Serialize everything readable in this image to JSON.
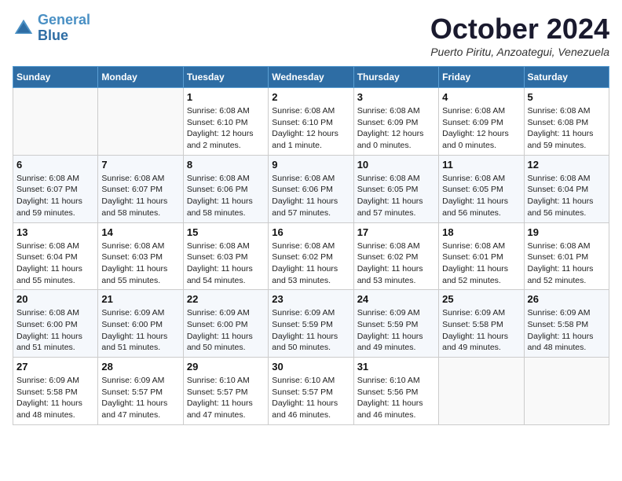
{
  "header": {
    "logo_line1": "General",
    "logo_line2": "Blue",
    "month": "October 2024",
    "location": "Puerto Piritu, Anzoategui, Venezuela"
  },
  "weekdays": [
    "Sunday",
    "Monday",
    "Tuesday",
    "Wednesday",
    "Thursday",
    "Friday",
    "Saturday"
  ],
  "weeks": [
    [
      {
        "day": "",
        "detail": ""
      },
      {
        "day": "",
        "detail": ""
      },
      {
        "day": "1",
        "detail": "Sunrise: 6:08 AM\nSunset: 6:10 PM\nDaylight: 12 hours\nand 2 minutes."
      },
      {
        "day": "2",
        "detail": "Sunrise: 6:08 AM\nSunset: 6:10 PM\nDaylight: 12 hours\nand 1 minute."
      },
      {
        "day": "3",
        "detail": "Sunrise: 6:08 AM\nSunset: 6:09 PM\nDaylight: 12 hours\nand 0 minutes."
      },
      {
        "day": "4",
        "detail": "Sunrise: 6:08 AM\nSunset: 6:09 PM\nDaylight: 12 hours\nand 0 minutes."
      },
      {
        "day": "5",
        "detail": "Sunrise: 6:08 AM\nSunset: 6:08 PM\nDaylight: 11 hours\nand 59 minutes."
      }
    ],
    [
      {
        "day": "6",
        "detail": "Sunrise: 6:08 AM\nSunset: 6:07 PM\nDaylight: 11 hours\nand 59 minutes."
      },
      {
        "day": "7",
        "detail": "Sunrise: 6:08 AM\nSunset: 6:07 PM\nDaylight: 11 hours\nand 58 minutes."
      },
      {
        "day": "8",
        "detail": "Sunrise: 6:08 AM\nSunset: 6:06 PM\nDaylight: 11 hours\nand 58 minutes."
      },
      {
        "day": "9",
        "detail": "Sunrise: 6:08 AM\nSunset: 6:06 PM\nDaylight: 11 hours\nand 57 minutes."
      },
      {
        "day": "10",
        "detail": "Sunrise: 6:08 AM\nSunset: 6:05 PM\nDaylight: 11 hours\nand 57 minutes."
      },
      {
        "day": "11",
        "detail": "Sunrise: 6:08 AM\nSunset: 6:05 PM\nDaylight: 11 hours\nand 56 minutes."
      },
      {
        "day": "12",
        "detail": "Sunrise: 6:08 AM\nSunset: 6:04 PM\nDaylight: 11 hours\nand 56 minutes."
      }
    ],
    [
      {
        "day": "13",
        "detail": "Sunrise: 6:08 AM\nSunset: 6:04 PM\nDaylight: 11 hours\nand 55 minutes."
      },
      {
        "day": "14",
        "detail": "Sunrise: 6:08 AM\nSunset: 6:03 PM\nDaylight: 11 hours\nand 55 minutes."
      },
      {
        "day": "15",
        "detail": "Sunrise: 6:08 AM\nSunset: 6:03 PM\nDaylight: 11 hours\nand 54 minutes."
      },
      {
        "day": "16",
        "detail": "Sunrise: 6:08 AM\nSunset: 6:02 PM\nDaylight: 11 hours\nand 53 minutes."
      },
      {
        "day": "17",
        "detail": "Sunrise: 6:08 AM\nSunset: 6:02 PM\nDaylight: 11 hours\nand 53 minutes."
      },
      {
        "day": "18",
        "detail": "Sunrise: 6:08 AM\nSunset: 6:01 PM\nDaylight: 11 hours\nand 52 minutes."
      },
      {
        "day": "19",
        "detail": "Sunrise: 6:08 AM\nSunset: 6:01 PM\nDaylight: 11 hours\nand 52 minutes."
      }
    ],
    [
      {
        "day": "20",
        "detail": "Sunrise: 6:08 AM\nSunset: 6:00 PM\nDaylight: 11 hours\nand 51 minutes."
      },
      {
        "day": "21",
        "detail": "Sunrise: 6:09 AM\nSunset: 6:00 PM\nDaylight: 11 hours\nand 51 minutes."
      },
      {
        "day": "22",
        "detail": "Sunrise: 6:09 AM\nSunset: 6:00 PM\nDaylight: 11 hours\nand 50 minutes."
      },
      {
        "day": "23",
        "detail": "Sunrise: 6:09 AM\nSunset: 5:59 PM\nDaylight: 11 hours\nand 50 minutes."
      },
      {
        "day": "24",
        "detail": "Sunrise: 6:09 AM\nSunset: 5:59 PM\nDaylight: 11 hours\nand 49 minutes."
      },
      {
        "day": "25",
        "detail": "Sunrise: 6:09 AM\nSunset: 5:58 PM\nDaylight: 11 hours\nand 49 minutes."
      },
      {
        "day": "26",
        "detail": "Sunrise: 6:09 AM\nSunset: 5:58 PM\nDaylight: 11 hours\nand 48 minutes."
      }
    ],
    [
      {
        "day": "27",
        "detail": "Sunrise: 6:09 AM\nSunset: 5:58 PM\nDaylight: 11 hours\nand 48 minutes."
      },
      {
        "day": "28",
        "detail": "Sunrise: 6:09 AM\nSunset: 5:57 PM\nDaylight: 11 hours\nand 47 minutes."
      },
      {
        "day": "29",
        "detail": "Sunrise: 6:10 AM\nSunset: 5:57 PM\nDaylight: 11 hours\nand 47 minutes."
      },
      {
        "day": "30",
        "detail": "Sunrise: 6:10 AM\nSunset: 5:57 PM\nDaylight: 11 hours\nand 46 minutes."
      },
      {
        "day": "31",
        "detail": "Sunrise: 6:10 AM\nSunset: 5:56 PM\nDaylight: 11 hours\nand 46 minutes."
      },
      {
        "day": "",
        "detail": ""
      },
      {
        "day": "",
        "detail": ""
      }
    ]
  ]
}
